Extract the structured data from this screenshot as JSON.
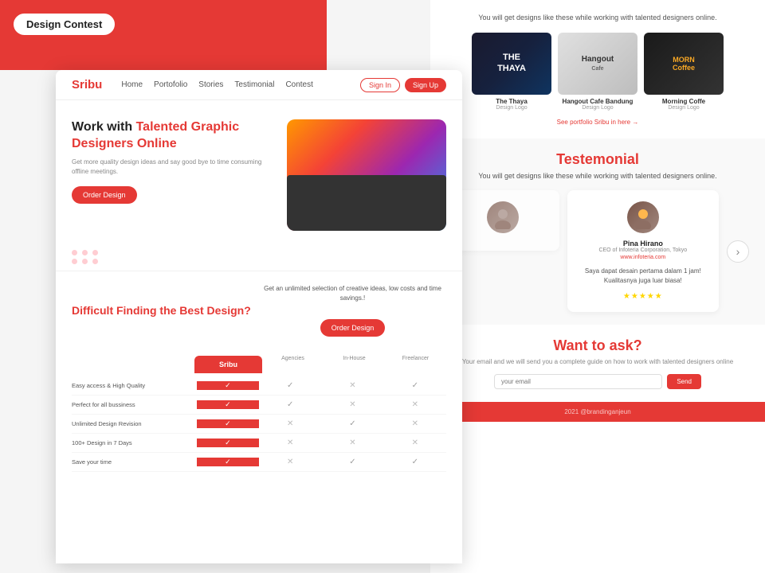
{
  "tag": {
    "label": "Design Contest"
  },
  "nav": {
    "logo": "Sribu",
    "links": [
      "Home",
      "Portofolio",
      "Stories",
      "Testimonial",
      "Contest"
    ],
    "signin": "Sign In",
    "signup": "Sign Up"
  },
  "hero": {
    "title_plain": "Work with ",
    "title_highlight": "Talented Graphic Designers Online",
    "subtitle": "Get more quality design ideas and say good bye to time consuming offline meetings.",
    "order_btn": "Order Design"
  },
  "difficult": {
    "title": "Difficult Finding the Best Design?",
    "description": "Get an unlimited selection of creative ideas, low costs and time savings.!",
    "order_btn": "Order Design"
  },
  "comparison": {
    "col_sribu": "Sribu",
    "col_agencies": "Agencies",
    "col_inhouse": "In-House",
    "col_freelancer": "Freelancer",
    "rows": [
      {
        "label": "Easy access & High Quality"
      },
      {
        "label": "Perfect for all bussiness"
      },
      {
        "label": "Unlimited Design Revision"
      },
      {
        "label": "100+ Design in 7 Days"
      },
      {
        "label": "Save your time"
      }
    ]
  },
  "portfolio": {
    "subtitle": "You will get designs like these while working with talented designers online.",
    "cards": [
      {
        "name": "The Thaya",
        "type": "Design Logo"
      },
      {
        "name": "Hangout Cafe Bandung",
        "type": "Design Logo"
      },
      {
        "name": "Morning Coffe",
        "type": "Design Logo"
      }
    ],
    "see_more": "See portfolio Sribu in here →"
  },
  "testimonial": {
    "title": "Testemonial",
    "subtitle": "You will get designs like these while working with talented designers online.",
    "person": {
      "name": "Pina Hirano",
      "role": "CEO of Infoteria Corporation, Tokyo",
      "link": "www.infoteria.com",
      "text": "Saya dapat desain pertama dalam 1 jam! Kualitasnya juga luar biasa!",
      "stars": "★★★★★"
    }
  },
  "want_to_ask": {
    "title": "Want to ask?",
    "subtitle": "Your email and we will send you a complete guide on how to work with talented designers online",
    "placeholder": "your email",
    "send_btn": "Send"
  },
  "footer": {
    "text": "2021 @brandinganjeun"
  }
}
